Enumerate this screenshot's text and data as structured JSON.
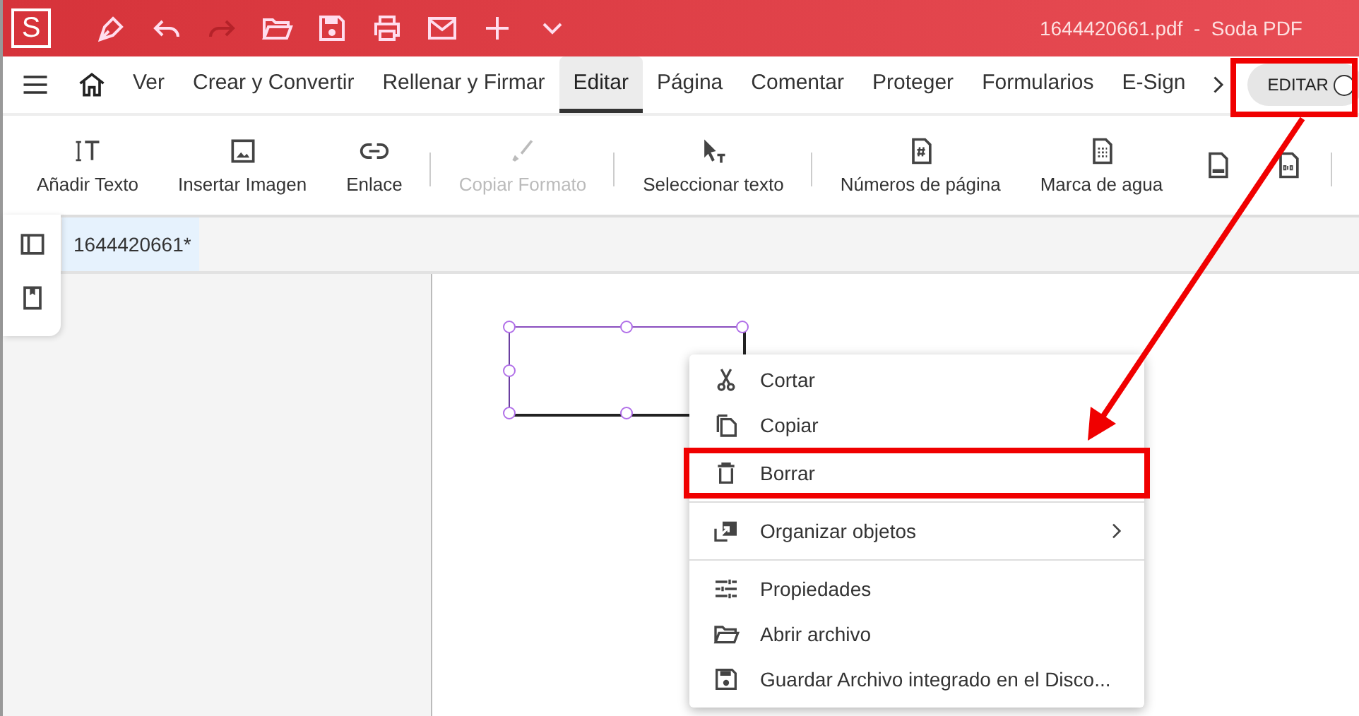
{
  "window": {
    "title": "1644420661.pdf  -  Soda PDF",
    "app_letter": "S"
  },
  "quick_actions": [
    {
      "disabled": false
    },
    {
      "disabled": false
    },
    {
      "disabled": true
    },
    {
      "disabled": false
    },
    {
      "disabled": false
    },
    {
      "disabled": false
    },
    {
      "disabled": false
    },
    {
      "disabled": false
    },
    {
      "disabled": false
    }
  ],
  "tabs": [
    {
      "label": "Ver",
      "selected": false
    },
    {
      "label": "Crear y Convertir",
      "selected": false
    },
    {
      "label": "Rellenar y Firmar",
      "selected": false
    },
    {
      "label": "Editar",
      "selected": true
    },
    {
      "label": "Página",
      "selected": false
    },
    {
      "label": "Comentar",
      "selected": false
    },
    {
      "label": "Proteger",
      "selected": false
    },
    {
      "label": "Formularios",
      "selected": false
    },
    {
      "label": "E-Sign",
      "selected": false
    }
  ],
  "edit_toggle": {
    "label": "EDITAR",
    "on": true,
    "highlighted": true
  },
  "toolbar": [
    {
      "label": "Añadir Texto",
      "disabled": false,
      "group_end": false
    },
    {
      "label": "Insertar Imagen",
      "disabled": false,
      "group_end": false
    },
    {
      "label": "Enlace",
      "disabled": false,
      "group_end": true
    },
    {
      "label": "Copiar Formato",
      "disabled": true,
      "group_end": true
    },
    {
      "label": "Seleccionar texto",
      "disabled": false,
      "group_end": true
    },
    {
      "label": "Números de página",
      "disabled": false,
      "group_end": false
    },
    {
      "label": "Marca de agua",
      "disabled": false,
      "group_end": false
    },
    {
      "disabled": false,
      "group_end": false
    },
    {
      "disabled": false,
      "group_end": true
    }
  ],
  "document_tabs": [
    {
      "label": "1644420661*",
      "selected": true
    }
  ],
  "shape": {
    "selected": true
  },
  "context_menu": [
    {
      "label": "Cortar",
      "divider_before": false,
      "submenu": false,
      "highlighted": false
    },
    {
      "label": "Copiar",
      "divider_before": false,
      "submenu": false,
      "highlighted": false
    },
    {
      "label": "Borrar",
      "divider_before": false,
      "submenu": false,
      "highlighted": true
    },
    {
      "label": "Organizar objetos",
      "divider_before": true,
      "submenu": true,
      "highlighted": false
    },
    {
      "label": "Propiedades",
      "divider_before": true,
      "submenu": false,
      "highlighted": false
    },
    {
      "label": "Abrir archivo",
      "divider_before": false,
      "submenu": false,
      "highlighted": false
    },
    {
      "label": "Guardar Archivo integrado en el Disco...",
      "divider_before": false,
      "submenu": false,
      "highlighted": false
    }
  ]
}
